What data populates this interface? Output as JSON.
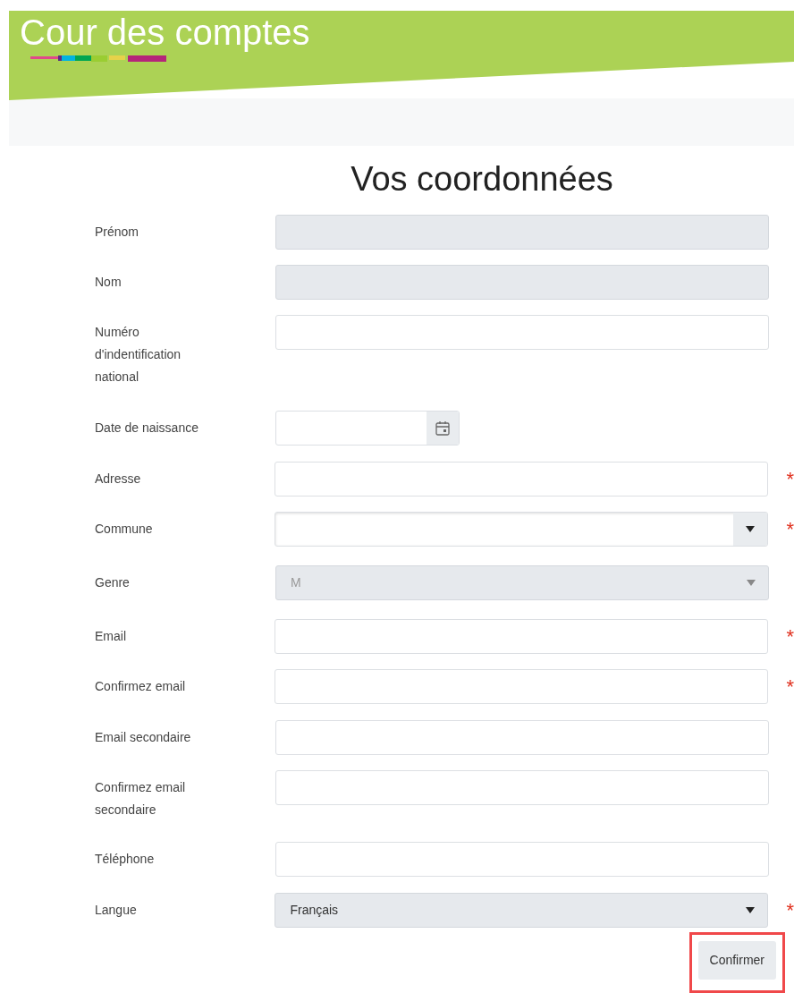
{
  "header": {
    "title": "Cour des comptes"
  },
  "form": {
    "title": "Vos coordonnées",
    "fields": [
      {
        "label": "Prénom",
        "kind": "text",
        "disabled": true
      },
      {
        "label": "Nom",
        "kind": "text",
        "disabled": true
      },
      {
        "label": "Numéro d'indentification national",
        "kind": "text",
        "disabled": false
      },
      {
        "label": "Date de naissance",
        "kind": "date",
        "disabled": false
      },
      {
        "label": "Adresse",
        "kind": "text",
        "disabled": false,
        "required_mark": "*"
      },
      {
        "label": "Commune",
        "kind": "select",
        "disabled": false,
        "required_mark": "*"
      },
      {
        "label": "Genre",
        "kind": "select",
        "disabled": true,
        "value": "M"
      },
      {
        "label": "Email",
        "kind": "text",
        "disabled": false,
        "required_mark": "*"
      },
      {
        "label": "Confirmez email",
        "kind": "text",
        "disabled": false,
        "required_mark": "*"
      },
      {
        "label": "Email secondaire",
        "kind": "text",
        "disabled": false
      },
      {
        "label": "Confirmez email secondaire",
        "kind": "text",
        "disabled": false
      },
      {
        "label": "Téléphone",
        "kind": "text",
        "disabled": false
      },
      {
        "label": "Langue",
        "kind": "select",
        "disabled": true,
        "value": "Français",
        "required_mark": "*"
      }
    ],
    "submit": {
      "label": "Confirmer",
      "highlighted": true
    }
  }
}
